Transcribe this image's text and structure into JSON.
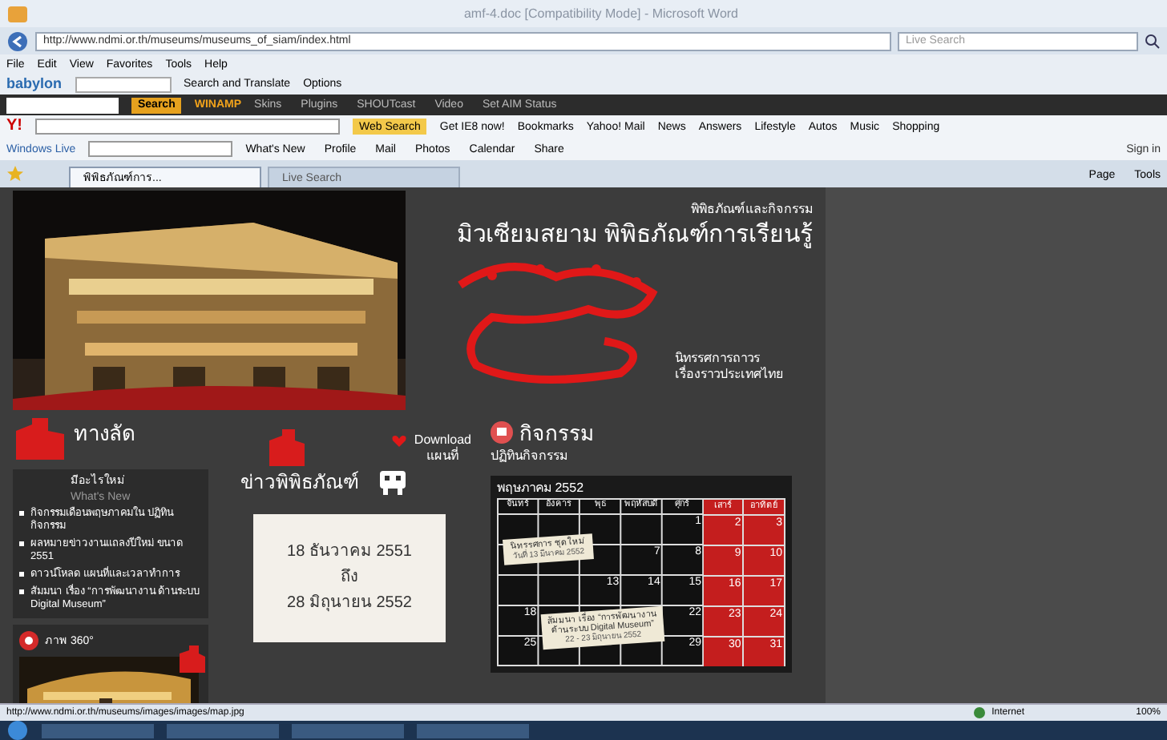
{
  "window": {
    "title": "amf-4.doc [Compatibility Mode] - Microsoft Word"
  },
  "address_bar": {
    "url": "http://www.ndmi.or.th/museums/museums_of_siam/index.html",
    "search_placeholder": "Live Search"
  },
  "menu": [
    "File",
    "Edit",
    "View",
    "Favorites",
    "Tools",
    "Help"
  ],
  "babylon_bar": {
    "brand": "babylon",
    "buttons": [
      "Search and Translate",
      "Options"
    ]
  },
  "winamp_bar": {
    "search_button": "Search",
    "brand": "WINAMP",
    "items": [
      "Skins",
      "Plugins",
      "SHOUTcast",
      "Video",
      "Set AIM Status"
    ]
  },
  "yahoo_bar": {
    "brand": "Y!",
    "search_button": "Web Search",
    "items": [
      "Get IE8 now!",
      "Bookmarks",
      "Yahoo! Mail",
      "News",
      "Answers",
      "Lifestyle",
      "Autos",
      "Music",
      "Shopping"
    ]
  },
  "live_bar": {
    "brand": "Windows Live",
    "items": [
      "What's New",
      "Profile",
      "Mail",
      "Photos",
      "Calendar",
      "Share"
    ],
    "sign_in": "Sign in"
  },
  "tabs": [
    {
      "label": "พิพิธภัณฑ์การ...",
      "selected": true
    },
    {
      "label": "Live Search",
      "selected": false
    }
  ],
  "command_bar": [
    "Page",
    "Tools"
  ],
  "page": {
    "header": {
      "subtitle": "พิพิธภัณฑ์และกิจกรรม",
      "title": "มิวเซียมสยาม พิพิธภัณฑ์การเรียนรู้",
      "exhibit_lines": [
        "นิทรรศการถาวร",
        "เรื่องราวประเทศไทย"
      ]
    },
    "shortcuts": {
      "heading": "ทางลัด",
      "whats_new_th": "มีอะไรใหม่",
      "whats_new_en": "What's New",
      "items": [
        "กิจกรรมเดือนพฤษภาคมใน ปฏิทินกิจกรรม",
        "ผลหมายข่าวงานแถลงปีใหม่ ขนาด 2551",
        "ดาวน์โหลด แผนที่และเวลาทำการ",
        "สัมมนา เรื่อง “การพัฒนางาน ด้านระบบ Digital Museum”"
      ],
      "panorama": "ภาพ 360°"
    },
    "download": [
      "Download",
      "แผนที่"
    ],
    "news": {
      "heading": "ข่าวพิพิธภัณฑ์",
      "note": [
        "18 ธันวาคม 2551",
        "ถึง",
        "28 มิถุนายน 2552"
      ]
    },
    "activities": {
      "heading": "กิจกรรม",
      "subheading": "ปฏิทินกิจกรรม",
      "month": "พฤษภาคม 2552",
      "weekdays": [
        {
          "label": "จันทร์",
          "weekend": false
        },
        {
          "label": "อังคาร",
          "weekend": false
        },
        {
          "label": "พุธ",
          "weekend": false
        },
        {
          "label": "พฤหัสบดี",
          "weekend": false
        },
        {
          "label": "ศุกร์",
          "weekend": false
        },
        {
          "label": "เสาร์",
          "weekend": true
        },
        {
          "label": "อาทิตย์",
          "weekend": true
        }
      ],
      "weeks": [
        [
          {
            "kind": "blank"
          },
          {
            "kind": "blank"
          },
          {
            "kind": "blank"
          },
          {
            "kind": "blank"
          },
          {
            "kind": "day",
            "day": "1"
          },
          {
            "kind": "day",
            "day": "2"
          },
          {
            "kind": "day",
            "day": "3"
          }
        ],
        [
          {
            "kind": "blank"
          },
          {
            "kind": "blank"
          },
          {
            "kind": "blank"
          },
          {
            "kind": "day",
            "day": "7"
          },
          {
            "kind": "day",
            "day": "8"
          },
          {
            "kind": "day",
            "day": "9"
          },
          {
            "kind": "day",
            "day": "10"
          }
        ],
        [
          {
            "kind": "blank"
          },
          {
            "kind": "blank"
          },
          {
            "kind": "day",
            "day": "13"
          },
          {
            "kind": "day",
            "day": "14"
          },
          {
            "kind": "day",
            "day": "15"
          },
          {
            "kind": "day",
            "day": "16"
          },
          {
            "kind": "day",
            "day": "17"
          }
        ],
        [
          {
            "kind": "day",
            "day": "18"
          },
          {
            "kind": "blank"
          },
          {
            "kind": "blank"
          },
          {
            "kind": "blank"
          },
          {
            "kind": "day",
            "day": "22"
          },
          {
            "kind": "day",
            "day": "23"
          },
          {
            "kind": "day",
            "day": "24"
          }
        ],
        [
          {
            "kind": "day",
            "day": "25"
          },
          {
            "kind": "blank"
          },
          {
            "kind": "blank"
          },
          {
            "kind": "blank"
          },
          {
            "kind": "day",
            "day": "29"
          },
          {
            "kind": "day",
            "day": "30"
          },
          {
            "kind": "day",
            "day": "31"
          }
        ]
      ],
      "notes": [
        {
          "title": "นิทรรศการ ชุดใหม่",
          "detail": "วันที่ 13 มีนาคม 2552"
        },
        {
          "title": "สัมมนา เรื่อง “การพัฒนางาน ด้านระบบ Digital Museum”",
          "detail": "22 - 23 มิถุนายน 2552"
        }
      ]
    }
  },
  "status_bar": {
    "url": "http://www.ndmi.or.th/museums/images/images/map.jpg",
    "zone": "Internet",
    "zoom": "100%"
  }
}
